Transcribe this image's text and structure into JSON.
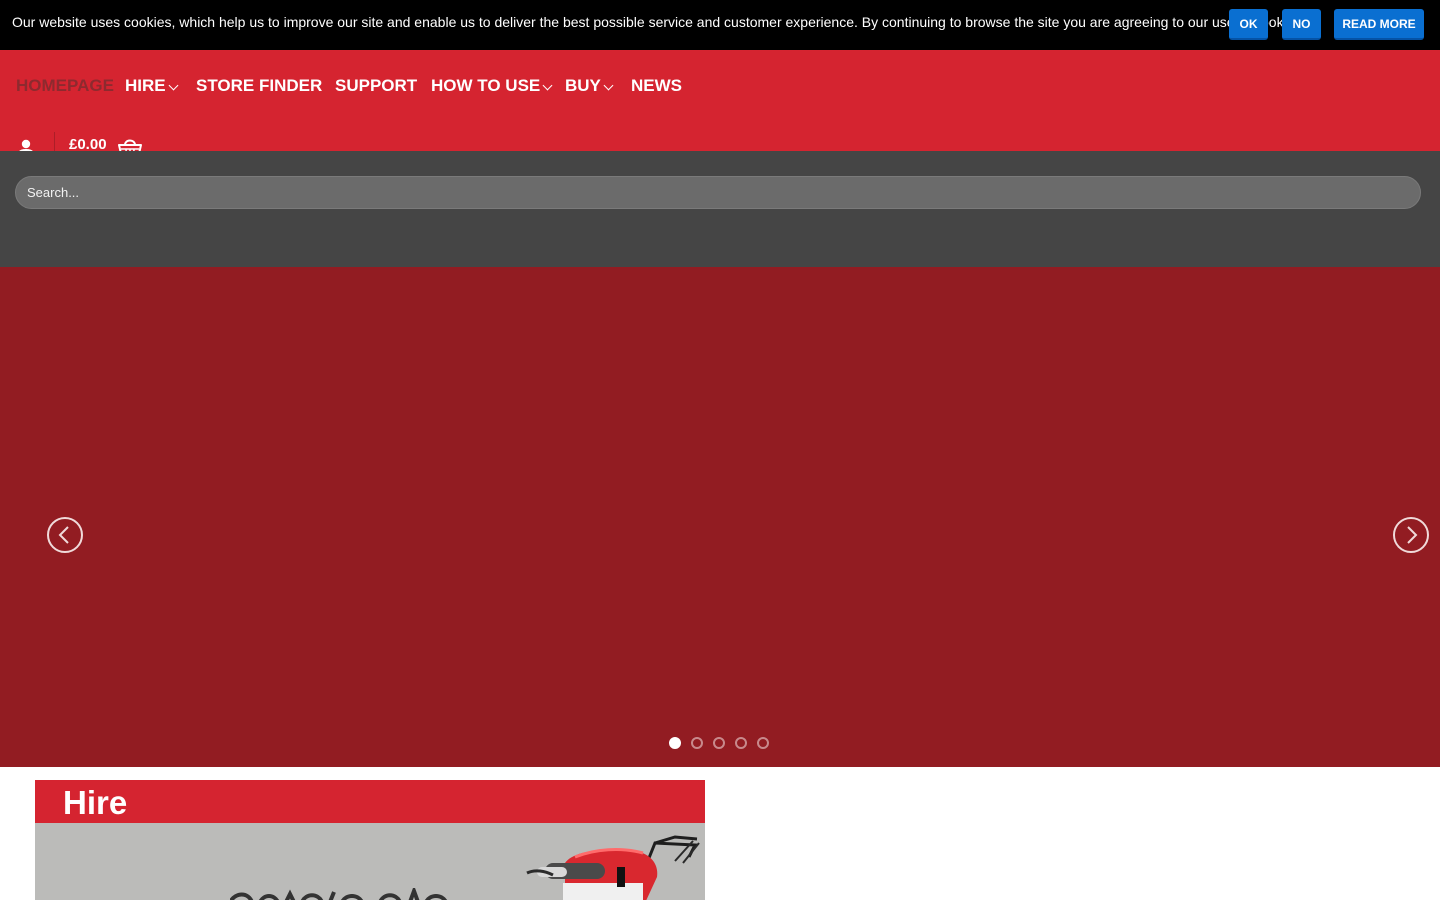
{
  "cookie_bar": {
    "message": "Our website uses cookies, which help us to improve our site and enable us to deliver the best possible service and customer experience. By continuing to browse the site you are agreeing to our use of cookies.",
    "ok_label": "OK",
    "no_label": "NO",
    "read_more_label": "READ MORE",
    "button_color": "#0a6fd1"
  },
  "nav": {
    "items": [
      {
        "label": "HOMEPAGE",
        "active": true,
        "has_dropdown": false
      },
      {
        "label": "HIRE",
        "active": false,
        "has_dropdown": true
      },
      {
        "label": "STORE FINDER",
        "active": false,
        "has_dropdown": false
      },
      {
        "label": "SUPPORT",
        "active": false,
        "has_dropdown": false
      },
      {
        "label": "HOW TO USE",
        "active": false,
        "has_dropdown": true
      },
      {
        "label": "BUY",
        "active": false,
        "has_dropdown": true
      },
      {
        "label": "NEWS",
        "active": false,
        "has_dropdown": false
      }
    ],
    "background_color": "#d52430"
  },
  "header": {
    "user_icon": "user-icon",
    "cart_total": "£0.00",
    "cart_icon": "basket-icon"
  },
  "search": {
    "placeholder": "Search..."
  },
  "slider": {
    "background_color": "#921c22",
    "prev_icon": "chevron-left-icon",
    "next_icon": "chevron-right-icon",
    "slide_count": 5,
    "active_slide": 1
  },
  "hire_card": {
    "title": "Hire"
  }
}
